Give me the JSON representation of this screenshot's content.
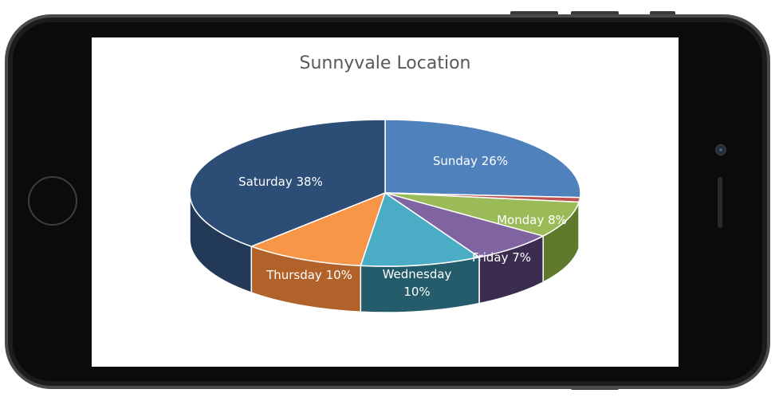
{
  "device": {
    "frame_color": "#2a2a2c",
    "bezel_color": "#0d0d0e"
  },
  "chart_data": {
    "type": "pie",
    "style": "3d",
    "title": "Sunnyvale Location",
    "slices": [
      {
        "label": "Sunday",
        "percent_label": "26%",
        "value": 26,
        "color": "#4f81bd",
        "side": "#2f5d8f"
      },
      {
        "label": "",
        "percent_label": "",
        "value": 1,
        "color": "#c0504d",
        "side": "#8c2f2d"
      },
      {
        "label": "Monday",
        "percent_label": "8%",
        "value": 8,
        "color": "#9bbb59",
        "side": "#5f7a2d"
      },
      {
        "label": "Friday",
        "percent_label": "7%",
        "value": 7,
        "color": "#8064a2",
        "side": "#3b2d4f"
      },
      {
        "label": "Wednesday",
        "percent_label": "10%",
        "value": 10,
        "color": "#4bacc6",
        "side": "#245c6c"
      },
      {
        "label": "Thursday",
        "percent_label": "10%",
        "value": 10,
        "color": "#f79646",
        "side": "#b0622a"
      },
      {
        "label": "Saturday",
        "percent_label": "38%",
        "value": 38,
        "color": "#2c4d75",
        "side": "#223a58"
      }
    ],
    "data_labels": [
      {
        "text": "Sunday 26%"
      },
      {
        "text": "Monday 8%"
      },
      {
        "text": "Friday 7%"
      },
      {
        "text": "Wednesday"
      },
      {
        "text": "10%"
      },
      {
        "text": "Thursday 10%"
      },
      {
        "text": "Saturday 38%"
      }
    ],
    "legend": "none"
  }
}
